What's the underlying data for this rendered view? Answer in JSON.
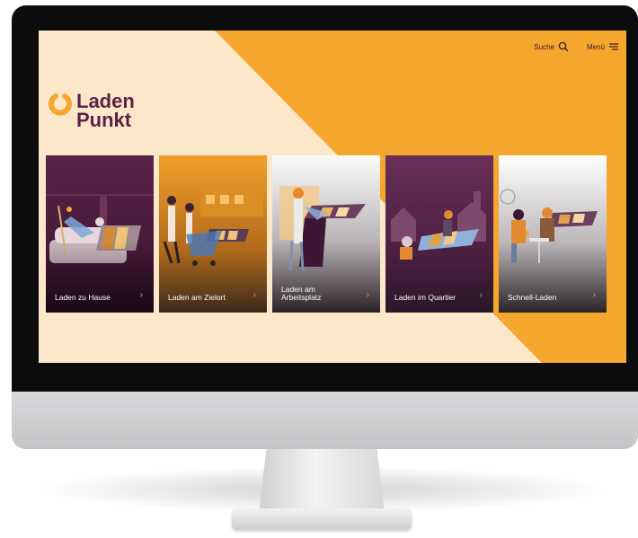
{
  "colors": {
    "cream": "#fde7cb",
    "orange": "#f4a62d",
    "plum": "#5a2247",
    "dark_plum": "#3b1735",
    "accent_orange": "#e8a33a"
  },
  "header": {
    "search_label": "Suche",
    "search_icon": "search-icon",
    "menu_label": "Menü",
    "menu_icon": "menu-icon"
  },
  "logo": {
    "line1": "Laden",
    "line2": "Punkt"
  },
  "cards": [
    {
      "label": "Laden zu Hause",
      "chevron": "›",
      "theme": "plum"
    },
    {
      "label": "Laden am Zielort",
      "chevron": "›",
      "theme": "orange"
    },
    {
      "label": "Laden am Arbeitsplatz",
      "chevron": "›",
      "theme": "light"
    },
    {
      "label": "Laden im Quartier",
      "chevron": "›",
      "theme": "plum"
    },
    {
      "label": "Schnell-Laden",
      "chevron": "›",
      "theme": "light"
    }
  ]
}
